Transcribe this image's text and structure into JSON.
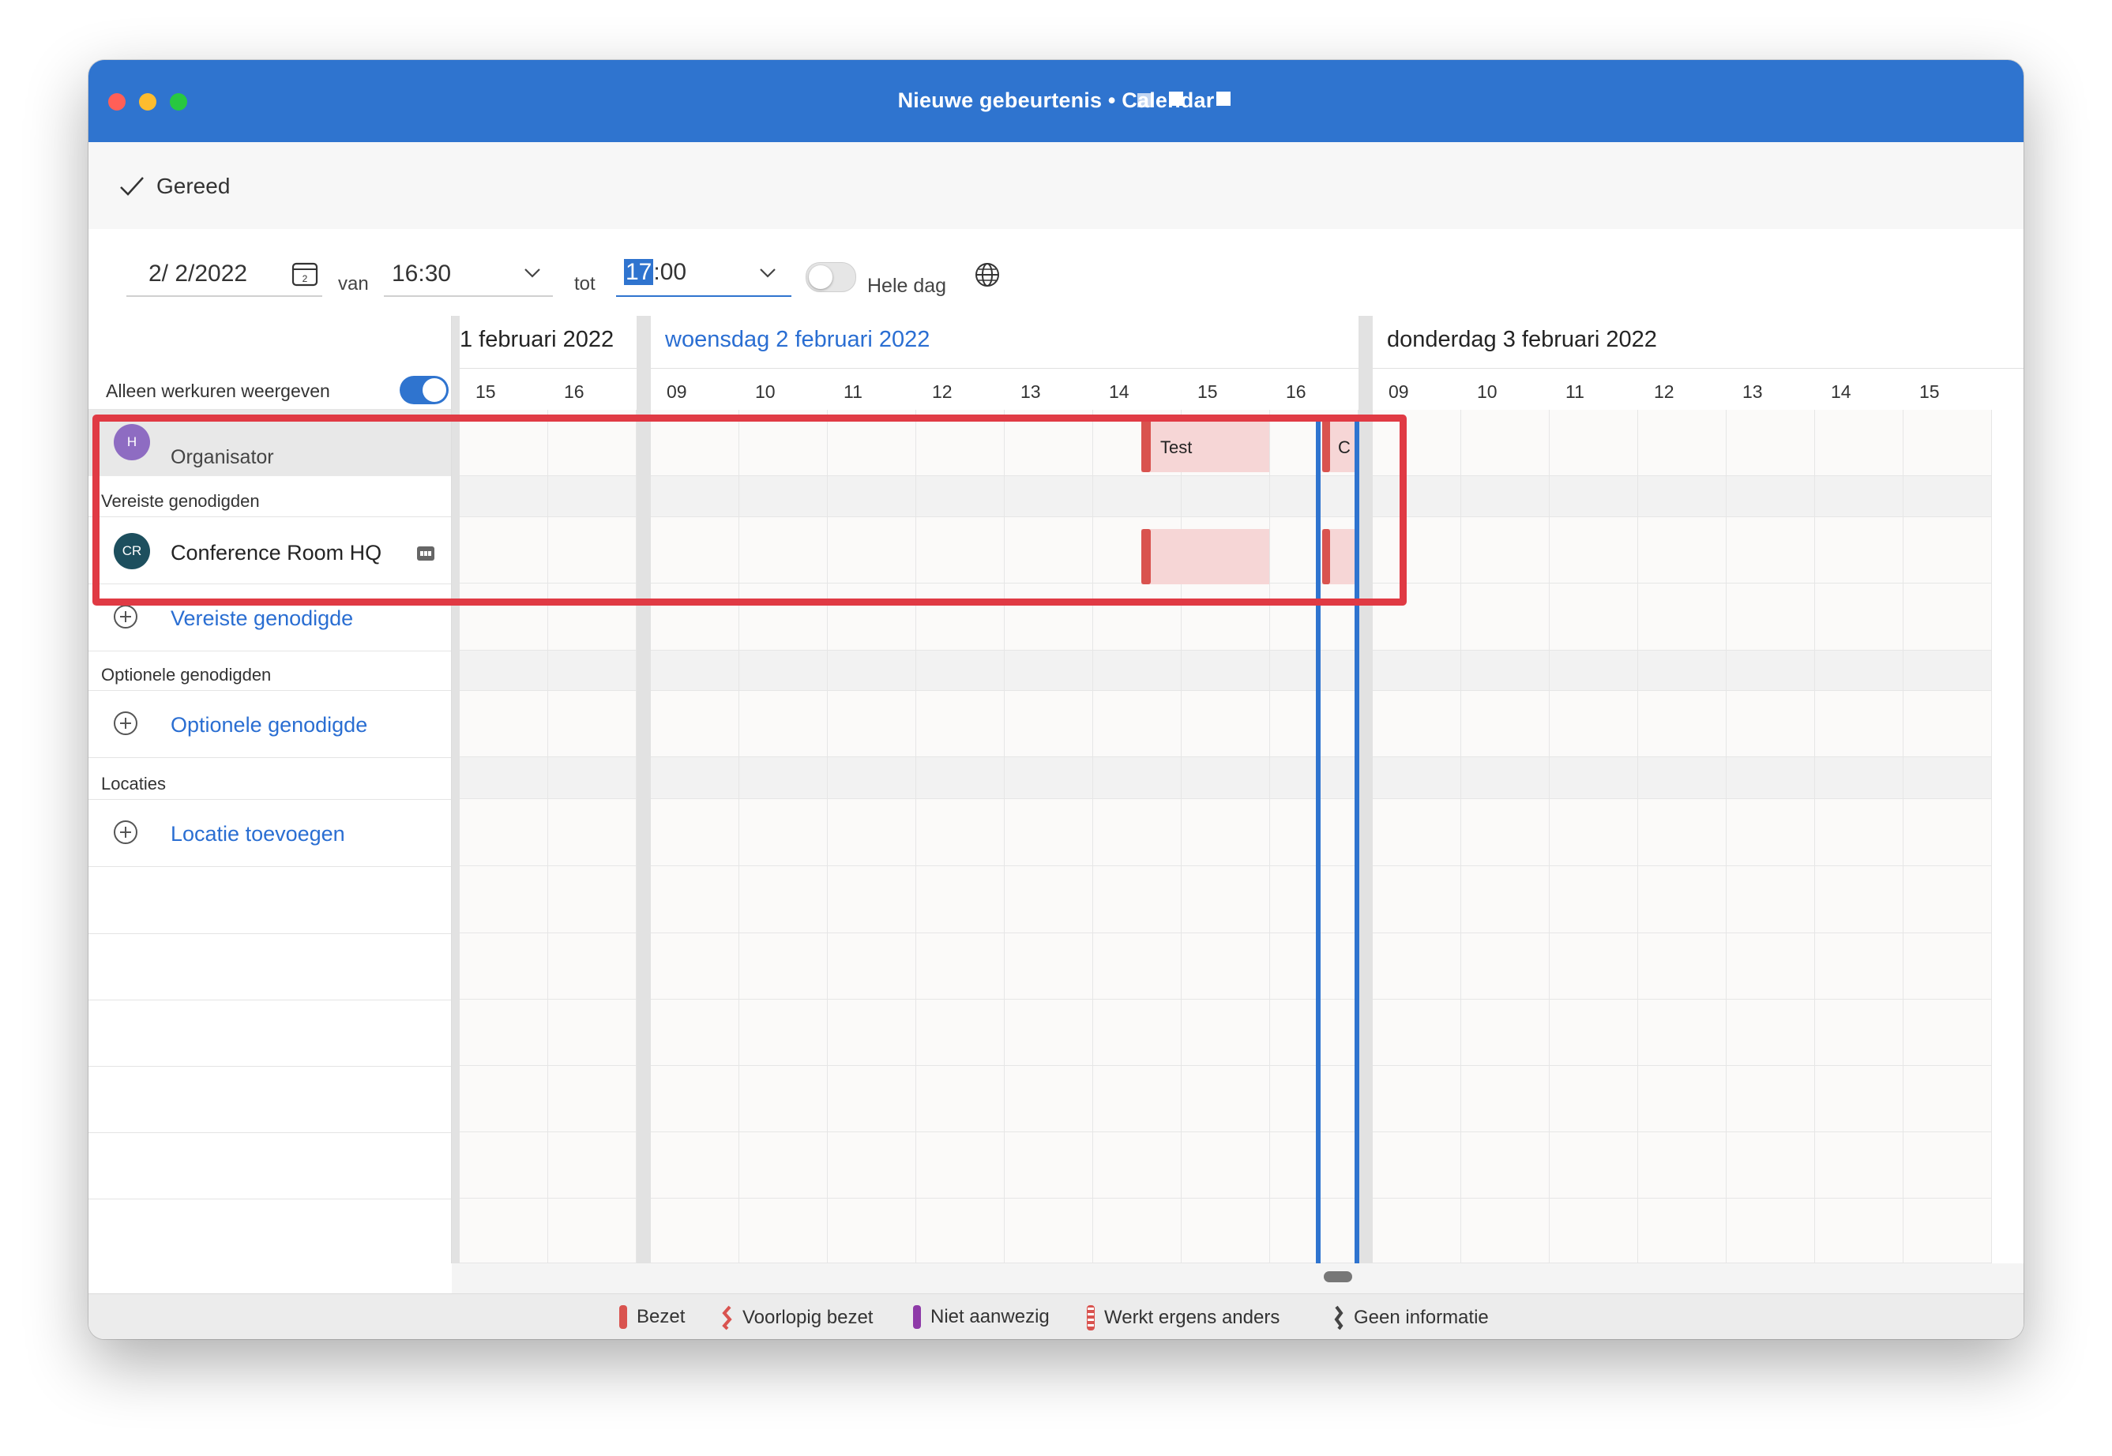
{
  "window": {
    "title": "Nieuwe gebeurtenis • Calendar"
  },
  "toolbar": {
    "done_label": "Gereed"
  },
  "form": {
    "date": "2/ 2/2022",
    "from_label": "van",
    "from_time": "16:30",
    "to_label": "tot",
    "to_time_hour": "17",
    "to_time_rest": ":00",
    "all_day_label": "Hele dag",
    "all_day": false
  },
  "schedule": {
    "work_hours_label": "Alleen werkuren weergeven",
    "work_hours_on": true,
    "organizer": {
      "initials": "H",
      "name_redacted": "••••",
      "role": "Organisator"
    },
    "required_section": "Vereiste genodigden",
    "room": {
      "initials": "CR",
      "name": "Conference Room HQ"
    },
    "add_required": "Vereiste genodigde",
    "optional_section": "Optionele genodigden",
    "add_optional": "Optionele genodigde",
    "locations_section": "Locaties",
    "add_location": "Locatie toevoegen"
  },
  "calendar": {
    "days": [
      {
        "label": "1 februari 2022",
        "hours": [
          "15",
          "16"
        ]
      },
      {
        "label": "woensdag 2 februari 2022",
        "hours": [
          "09",
          "10",
          "11",
          "12",
          "13",
          "14",
          "15",
          "16"
        ],
        "current": true
      },
      {
        "label": "donderdag 3 februari 2022",
        "hours": [
          "09",
          "10",
          "11",
          "12",
          "13",
          "14",
          "15"
        ]
      }
    ],
    "events": [
      {
        "title": "Test"
      },
      {
        "title": "C"
      }
    ]
  },
  "legend": [
    {
      "label": "Bezet",
      "color": "#d9534f"
    },
    {
      "label": "Voorlopig bezet",
      "color": "#d9534f"
    },
    {
      "label": "Niet aanwezig",
      "color": "#8e3aa8"
    },
    {
      "label": "Werkt ergens anders",
      "color": "#d9534f"
    },
    {
      "label": "Geen informatie",
      "color": "#444444"
    }
  ],
  "colors": {
    "accent": "#2f74cf",
    "busy": "#d9534f",
    "busy_fill": "#f6d6d6",
    "highlight": "#e03a44"
  }
}
